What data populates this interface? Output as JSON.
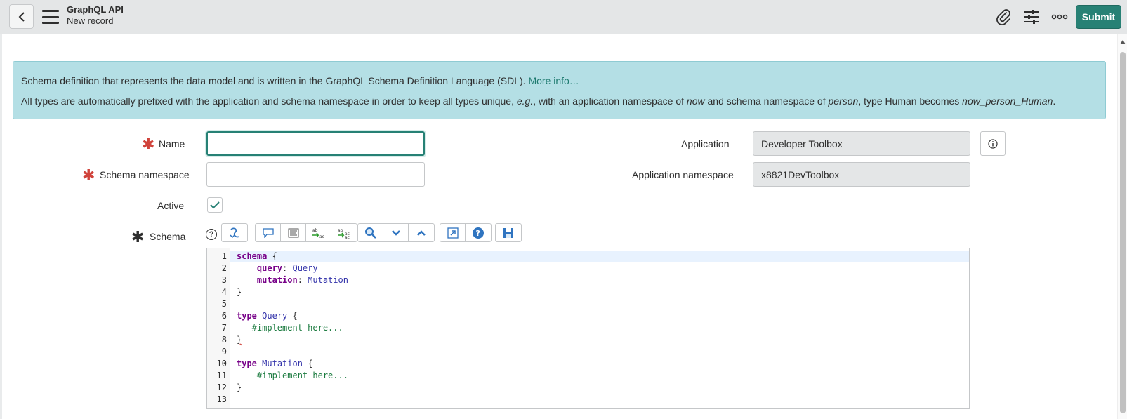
{
  "header": {
    "title": "GraphQL API",
    "subtitle": "New record",
    "submit_label": "Submit"
  },
  "banner": {
    "line1_text": "Schema definition that represents the data model and is written in the GraphQL Schema Definition Language (SDL).",
    "line1_link": "More info…",
    "line2_a": "All types are automatically prefixed with the application and schema namespace in order to keep all types unique, ",
    "line2_eg": "e.g.",
    "line2_b": ", with an application namespace of ",
    "line2_now": "now",
    "line2_c": " and schema namespace of ",
    "line2_person": "person",
    "line2_d": ", type Human becomes ",
    "line2_result": "now_person_Human",
    "line2_e": "."
  },
  "form": {
    "name_label": "Name",
    "name_value": "",
    "schema_namespace_label": "Schema namespace",
    "schema_namespace_value": "",
    "active_label": "Active",
    "active_checked": true,
    "schema_label": "Schema",
    "application_label": "Application",
    "application_value": "Developer Toolbox",
    "app_namespace_label": "Application namespace",
    "app_namespace_value": "x8821DevToolbox"
  },
  "toolbar": {
    "buttons": [
      "format-code-icon",
      "comment-icon",
      "outline-icon",
      "replace-icon",
      "replace-all-icon",
      "search-icon",
      "collapse-icon",
      "expand-icon",
      "fullscreen-icon",
      "help-icon",
      "save-icon"
    ]
  },
  "editor": {
    "line_numbers": [
      "1",
      "2",
      "3",
      "4",
      "5",
      "6",
      "7",
      "8",
      "9",
      "10",
      "11",
      "12",
      "13"
    ],
    "lines": [
      "schema {",
      "    query: Query",
      "    mutation: Mutation",
      "}",
      "",
      "type Query {",
      "   #implement here...",
      "}",
      "",
      "type Mutation {",
      "    #implement here...",
      "}",
      ""
    ]
  },
  "colors": {
    "accent": "#278175",
    "banner_bg": "#b4dfe5",
    "required": "#d0433b"
  }
}
